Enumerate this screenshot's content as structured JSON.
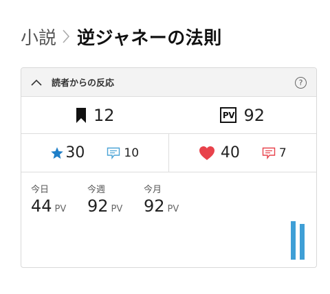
{
  "breadcrumb": {
    "category": "小説",
    "title": "逆ジャネーの法則"
  },
  "reactions": {
    "header_title": "読者からの反応",
    "help_label": "?",
    "bookmarks": "12",
    "pv_badge": "PV",
    "page_views": "92",
    "stars": "30",
    "star_comments": "10",
    "likes": "40",
    "like_comments": "7"
  },
  "periods": [
    {
      "label": "今日",
      "value": "44",
      "unit": "PV"
    },
    {
      "label": "今週",
      "value": "92",
      "unit": "PV"
    },
    {
      "label": "今月",
      "value": "92",
      "unit": "PV"
    }
  ],
  "colors": {
    "star": "#1f7fc8",
    "comment_blue": "#4aa3d6",
    "heart": "#e8424b",
    "comment_red": "#e8424b",
    "bar": "#3f9fd6"
  }
}
